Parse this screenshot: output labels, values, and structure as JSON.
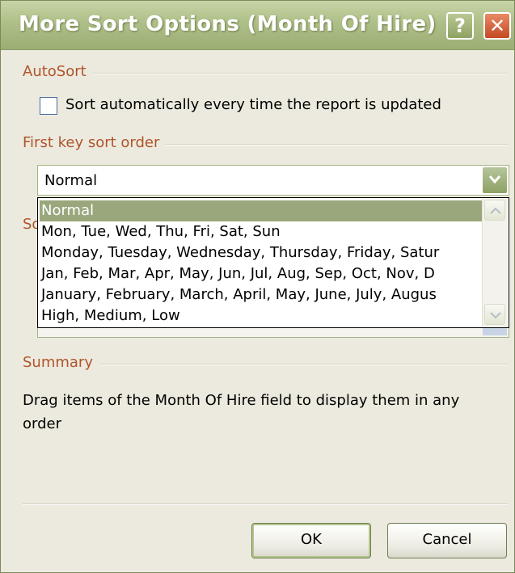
{
  "dialog": {
    "title": "More Sort Options (Month Of Hire)",
    "help_label": "?",
    "close_label": "✕"
  },
  "autosort": {
    "group_label": "AutoSort",
    "checkbox_label": "Sort automatically every time the report is updated",
    "checked": false
  },
  "first_key": {
    "group_label": "First key sort order",
    "selected_value": "Normal",
    "options": [
      "Normal",
      "Mon, Tue, Wed, Thu, Fri, Sat, Sun",
      "Monday, Tuesday, Wednesday, Thursday, Friday, Satur",
      "Jan, Feb, Mar, Apr, May, Jun, Jul, Aug, Sep, Oct, Nov, D",
      "January, February, March, April, May, June, July, Augus",
      "High, Medium, Low"
    ],
    "highlighted_index": 0
  },
  "obscured_group": {
    "visible_label_fragment": "So"
  },
  "summary": {
    "group_label": "Summary",
    "text": "Drag items of the Month Of Hire field to display them in any order"
  },
  "buttons": {
    "ok": "OK",
    "cancel": "Cancel"
  },
  "colors": {
    "titlebar": "#aebf88",
    "group_label": "#b0542c",
    "highlight": "#9aa77d",
    "dialog_bg": "#eceade"
  }
}
